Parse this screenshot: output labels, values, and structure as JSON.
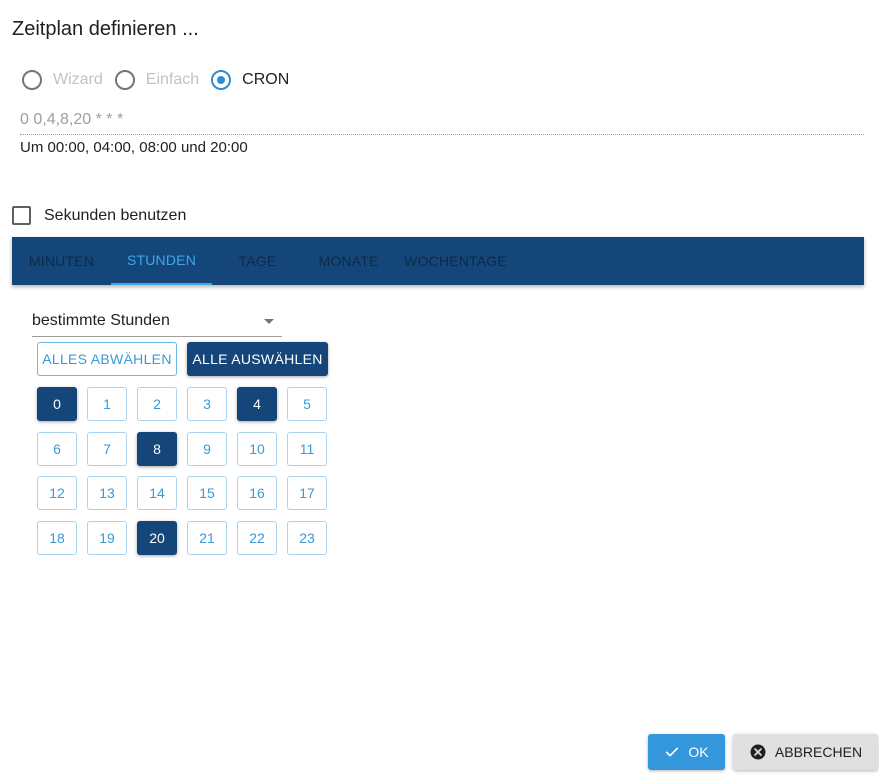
{
  "dialog": {
    "title": "Zeitplan definieren ..."
  },
  "modes": [
    {
      "label": "Wizard",
      "checked": false
    },
    {
      "label": "Einfach",
      "checked": false
    },
    {
      "label": "CRON",
      "checked": true
    }
  ],
  "cron": {
    "expression": "0 0,4,8,20 * * *",
    "description": "Um 00:00, 04:00, 08:00 und 20:00"
  },
  "seconds": {
    "label": "Sekunden benutzen",
    "checked": false
  },
  "tabs": [
    {
      "label": "MINUTEN",
      "active": false
    },
    {
      "label": "STUNDEN",
      "active": true
    },
    {
      "label": "TAGE",
      "active": false
    },
    {
      "label": "MONATE",
      "active": false
    },
    {
      "label": "WOCHENTAGE",
      "active": false
    }
  ],
  "hours_panel": {
    "select_value": "bestimmte Stunden",
    "deselect_all_label": "ALLES ABWÄHLEN",
    "select_all_label": "ALLE AUSWÄHLEN",
    "hours": [
      "0",
      "1",
      "2",
      "3",
      "4",
      "5",
      "6",
      "7",
      "8",
      "9",
      "10",
      "11",
      "12",
      "13",
      "14",
      "15",
      "16",
      "17",
      "18",
      "19",
      "20",
      "21",
      "22",
      "23"
    ],
    "selected": [
      "0",
      "4",
      "8",
      "20"
    ]
  },
  "actions": {
    "ok_label": "OK",
    "cancel_label": "ABBRECHEN"
  },
  "icons": {
    "ok": "check-icon",
    "cancel": "close-circle-icon",
    "select": "chevron-down-icon"
  },
  "colors": {
    "primary": "#15467a",
    "accent": "#3497db",
    "tab_active": "#40a6e6"
  }
}
